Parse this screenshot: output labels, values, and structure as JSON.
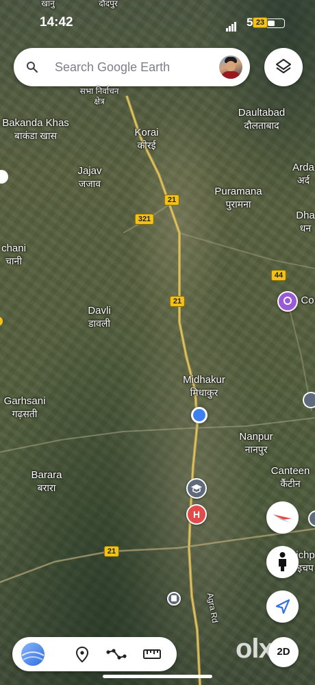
{
  "status_bar": {
    "time": "14:42",
    "battery": "5"
  },
  "search": {
    "placeholder": "Search Google Earth"
  },
  "map": {
    "labels_top_cut": [
      "खानु",
      "दौदपुर"
    ],
    "places": [
      {
        "id": "sabha",
        "en": "सभा निर्वाचन",
        "hi": "क्षेत्र"
      },
      {
        "id": "bakanda",
        "en": "Bakanda Khas",
        "hi": "बाकंडा खास"
      },
      {
        "id": "korai",
        "en": "Korai",
        "hi": "कोरई"
      },
      {
        "id": "daultabad",
        "en": "Daultabad",
        "hi": "दौलताबाद"
      },
      {
        "id": "jajav",
        "en": "Jajav",
        "hi": "जजाव"
      },
      {
        "id": "arda",
        "en": "Arda",
        "hi": "अर्द"
      },
      {
        "id": "puramana",
        "en": "Puramana",
        "hi": "पुरामना"
      },
      {
        "id": "dha",
        "en": "Dha",
        "hi": "धन"
      },
      {
        "id": "chani",
        "en": "chani",
        "hi": "चानी"
      },
      {
        "id": "davli",
        "en": "Davli",
        "hi": "डावली"
      },
      {
        "id": "midhakur",
        "en": "Midhakur",
        "hi": "मिधाकुर"
      },
      {
        "id": "garhsani",
        "en": "Garhsani",
        "hi": "गढ़सती"
      },
      {
        "id": "nanpur",
        "en": "Nanpur",
        "hi": "नानपुर"
      },
      {
        "id": "canteen",
        "en": "Canteen",
        "hi": "कैंटीन"
      },
      {
        "id": "barara",
        "en": "Barara",
        "hi": "बरारा"
      },
      {
        "id": "ichp",
        "en": "ichp",
        "hi": "इचप"
      },
      {
        "id": "co",
        "en": "Co",
        "hi": ""
      }
    ],
    "road_labels": {
      "r21_top": "21",
      "r321": "321",
      "r21_mid": "21",
      "r44": "44",
      "r21_bottom": "21",
      "r23": "23",
      "agra_rd": "Agra Rd"
    },
    "hospital_letter": "H"
  },
  "controls": {
    "two_d_label": "2D"
  },
  "watermark": "olx",
  "colors": {
    "road_yellow": "#f2c21a",
    "location_blue": "#3d7ff0",
    "hospital_red": "#e34a4a",
    "school_gray": "#5f6b7a",
    "poi_purple": "#9a5ad6",
    "earth_blue": "#2f6fe0"
  }
}
